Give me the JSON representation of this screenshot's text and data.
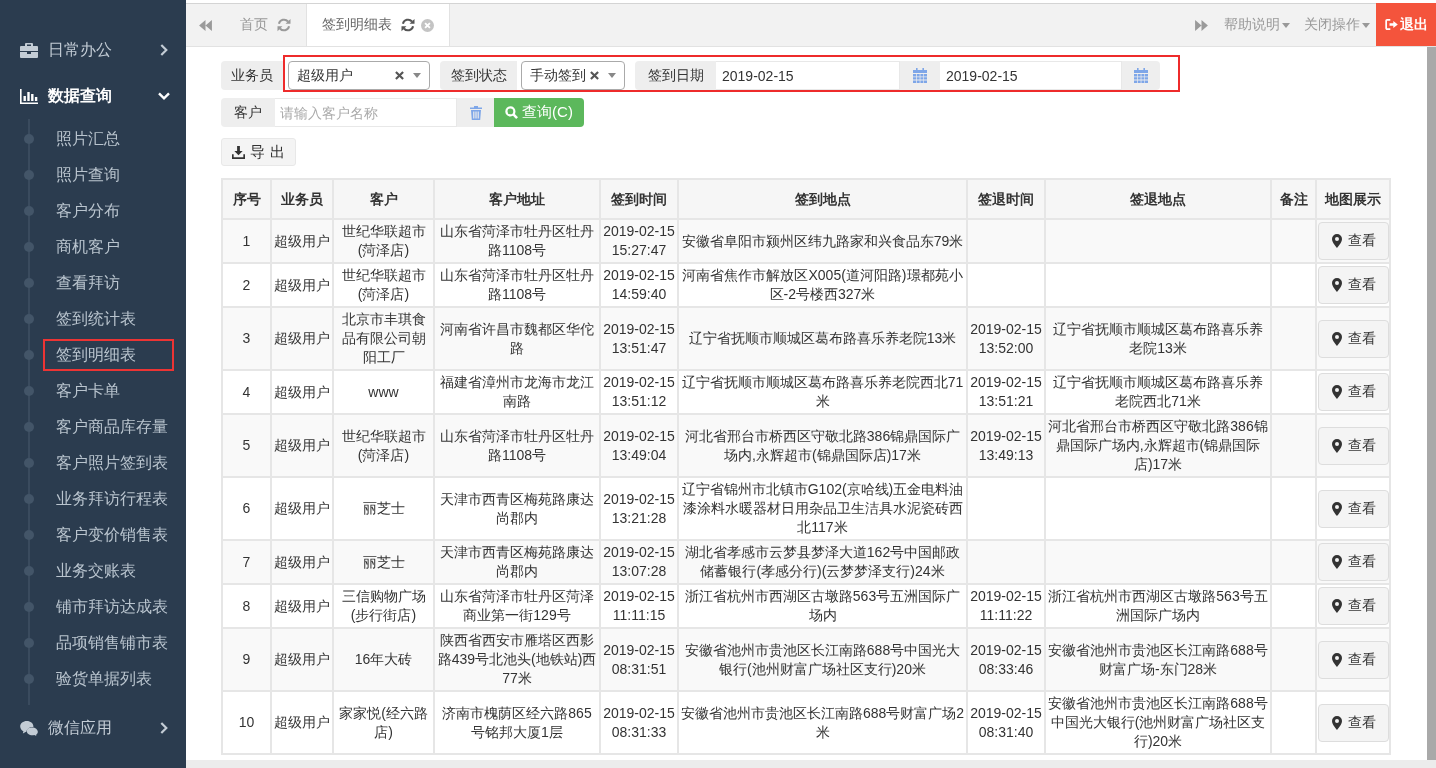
{
  "sidebar": {
    "groups": [
      {
        "label": "日常办公",
        "expanded": false
      },
      {
        "label": "数据查询",
        "expanded": true,
        "children": [
          {
            "label": "照片汇总",
            "highlighted": false
          },
          {
            "label": "照片查询",
            "highlighted": false
          },
          {
            "label": "客户分布",
            "highlighted": false
          },
          {
            "label": "商机客户",
            "highlighted": false
          },
          {
            "label": "查看拜访",
            "highlighted": false
          },
          {
            "label": "签到统计表",
            "highlighted": false
          },
          {
            "label": "签到明细表",
            "highlighted": true
          },
          {
            "label": "客户卡单",
            "highlighted": false
          },
          {
            "label": "客户商品库存量",
            "highlighted": false
          },
          {
            "label": "客户照片签到表",
            "highlighted": false
          },
          {
            "label": "业务拜访行程表",
            "highlighted": false
          },
          {
            "label": "客户变价销售表",
            "highlighted": false
          },
          {
            "label": "业务交账表",
            "highlighted": false
          },
          {
            "label": "铺市拜访达成表",
            "highlighted": false
          },
          {
            "label": "品项销售铺市表",
            "highlighted": false
          },
          {
            "label": "验货单据列表",
            "highlighted": false
          }
        ]
      },
      {
        "label": "微信应用",
        "expanded": false
      }
    ]
  },
  "tabs": {
    "items": [
      {
        "label": "首页",
        "selected": false,
        "closable": false
      },
      {
        "label": "签到明细表",
        "selected": true,
        "closable": true
      }
    ],
    "menus": [
      {
        "label": "帮助说明"
      },
      {
        "label": "关闭操作"
      }
    ],
    "logout": "退出"
  },
  "filters": {
    "highlighted": true,
    "salesman": {
      "label": "业务员",
      "value": "超级用户"
    },
    "status": {
      "label": "签到状态",
      "value": "手动签到"
    },
    "date": {
      "label": "签到日期",
      "from": "2019-02-15",
      "to": "2019-02-15"
    },
    "customer": {
      "label": "客户",
      "placeholder": "请输入客户名称"
    },
    "search_button": "查询(C)"
  },
  "export_button": "导 出",
  "table": {
    "columns": [
      {
        "label": "序号"
      },
      {
        "label": "业务员"
      },
      {
        "label": "客户"
      },
      {
        "label": "客户地址"
      },
      {
        "label": "签到时间"
      },
      {
        "label": "签到地点"
      },
      {
        "label": "签退时间"
      },
      {
        "label": "签退地点"
      },
      {
        "label": "备注"
      },
      {
        "label": "地图展示"
      }
    ],
    "rows": [
      {
        "no": "1",
        "salesman": "超级用户",
        "customer": "世纪华联超市(菏泽店)",
        "address": "山东省菏泽市牡丹区牡丹路1108号",
        "checkin_time": "2019-02-15 15:27:47",
        "checkin_place": "安徽省阜阳市颍州区纬九路家和兴食品东79米",
        "action": "查看"
      },
      {
        "no": "2",
        "salesman": "超级用户",
        "customer": "世纪华联超市(菏泽店)",
        "address": "山东省菏泽市牡丹区牡丹路1108号",
        "checkin_time": "2019-02-15 14:59:40",
        "checkin_place": "河南省焦作市解放区X005(道河阳路)璟都苑小区-2号楼西327米",
        "action": "查看"
      },
      {
        "no": "3",
        "salesman": "超级用户",
        "customer": "北京市丰琪食品有限公司朝阳工厂",
        "address": "河南省许昌市魏都区华佗路",
        "checkin_time": "2019-02-15 13:51:47",
        "checkin_place": "辽宁省抚顺市顺城区葛布路喜乐养老院13米",
        "checkout_time": "2019-02-15 13:52:00",
        "checkout_place": "辽宁省抚顺市顺城区葛布路喜乐养老院13米",
        "action": "查看"
      },
      {
        "no": "4",
        "salesman": "超级用户",
        "customer": "www",
        "address": "福建省漳州市龙海市龙江南路",
        "checkin_time": "2019-02-15 13:51:12",
        "checkin_place": "辽宁省抚顺市顺城区葛布路喜乐养老院西北71米",
        "checkout_time": "2019-02-15 13:51:21",
        "checkout_place": "辽宁省抚顺市顺城区葛布路喜乐养老院西北71米",
        "action": "查看"
      },
      {
        "no": "5",
        "salesman": "超级用户",
        "customer": "世纪华联超市(菏泽店)",
        "address": "山东省菏泽市牡丹区牡丹路1108号",
        "checkin_time": "2019-02-15 13:49:04",
        "checkin_place": "河北省邢台市桥西区守敬北路386锦鼎国际广场内,永辉超市(锦鼎国际店)17米",
        "checkout_time": "2019-02-15 13:49:13",
        "checkout_place": "河北省邢台市桥西区守敬北路386锦鼎国际广场内,永辉超市(锦鼎国际店)17米",
        "action": "查看"
      },
      {
        "no": "6",
        "salesman": "超级用户",
        "customer": "丽芝士",
        "address": "天津市西青区梅苑路康达尚郡内",
        "checkin_time": "2019-02-15 13:21:28",
        "checkin_place": "辽宁省锦州市北镇市G102(京哈线)五金电料油漆涂料水暖器材日用杂品卫生洁具水泥瓷砖西北117米",
        "action": "查看"
      },
      {
        "no": "7",
        "salesman": "超级用户",
        "customer": "丽芝士",
        "address": "天津市西青区梅苑路康达尚郡内",
        "checkin_time": "2019-02-15 13:07:28",
        "checkin_place": "湖北省孝感市云梦县梦泽大道162号中国邮政储蓄银行(孝感分行)(云梦梦泽支行)24米",
        "action": "查看"
      },
      {
        "no": "8",
        "salesman": "超级用户",
        "customer": "三信购物广场(步行街店)",
        "address": "山东省菏泽市牡丹区菏泽商业第一街129号",
        "checkin_time": "2019-02-15 11:11:15",
        "checkin_place": "浙江省杭州市西湖区古墩路563号五洲国际广场内",
        "checkout_time": "2019-02-15 11:11:22",
        "checkout_place": "浙江省杭州市西湖区古墩路563号五洲国际广场内",
        "action": "查看"
      },
      {
        "no": "9",
        "salesman": "超级用户",
        "customer": "16年大砖",
        "address": "陕西省西安市雁塔区西影路439号北池头(地铁站)西77米",
        "checkin_time": "2019-02-15 08:31:51",
        "checkin_place": "安徽省池州市贵池区长江南路688号中国光大银行(池州财富广场社区支行)20米",
        "checkout_time": "2019-02-15 08:33:46",
        "checkout_place": "安徽省池州市贵池区长江南路688号财富广场-东门28米",
        "action": "查看"
      },
      {
        "no": "10",
        "salesman": "超级用户",
        "customer": "家家悦(经六路店)",
        "address": "济南市槐荫区经六路865号铭邦大厦1层",
        "checkin_time": "2019-02-15 08:31:33",
        "checkin_place": "安徽省池州市贵池区长江南路688号财富广场2米",
        "checkout_time": "2019-02-15 08:31:40",
        "checkout_place": "安徽省池州市贵池区长江南路688号中国光大银行(池州财富广场社区支行)20米",
        "action": "查看"
      }
    ]
  }
}
